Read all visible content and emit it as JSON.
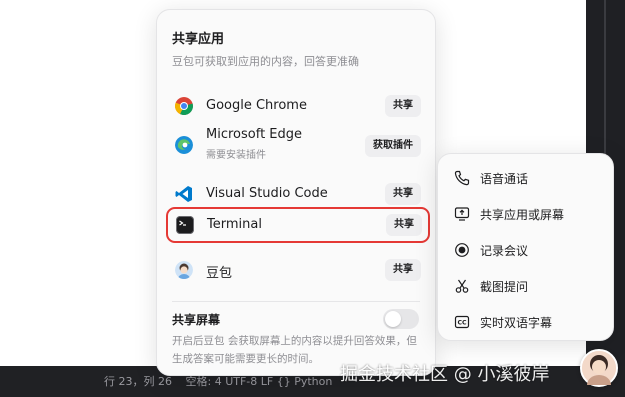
{
  "share_apps": {
    "title": "共享应用",
    "description": "豆包可获取到应用的内容，回答更准确",
    "apps": [
      {
        "name": "Google Chrome",
        "button": "共享",
        "icon": "chrome-icon"
      },
      {
        "name": "Microsoft Edge",
        "subtitle": "需要安装插件",
        "button": "获取插件",
        "icon": "edge-icon"
      },
      {
        "name": "Visual Studio Code",
        "button": "共享",
        "icon": "vscode-icon"
      },
      {
        "name": "Terminal",
        "button": "共享",
        "icon": "terminal-icon",
        "highlight_color": "#e53935"
      },
      {
        "name": "豆包",
        "button": "共享",
        "icon": "doubao-icon"
      }
    ]
  },
  "share_screen": {
    "title": "共享屏幕",
    "description": "开启后豆包 会获取屏幕上的内容以提升回答效果，但生成答案可能需要更长的时间。",
    "toggle_on": false
  },
  "tools_menu": {
    "items": [
      {
        "label": "语音通话",
        "icon": "phone-icon"
      },
      {
        "label": "共享应用或屏幕",
        "icon": "screen-share-icon"
      },
      {
        "label": "记录会议",
        "icon": "record-icon"
      },
      {
        "label": "截图提问",
        "icon": "scissors-icon"
      },
      {
        "label": "实时双语字幕",
        "icon": "subtitles-icon"
      }
    ]
  },
  "status_bar": {
    "position": "行 23，列 26",
    "rest": "空格: 4   UTF-8   LF   {} Python"
  },
  "watermark": "掘金技术社区 @ 小溪彼岸",
  "colors": {
    "highlight": "#e53935",
    "panel_bg": "#fafafa",
    "button_bg": "#eeeef0"
  }
}
